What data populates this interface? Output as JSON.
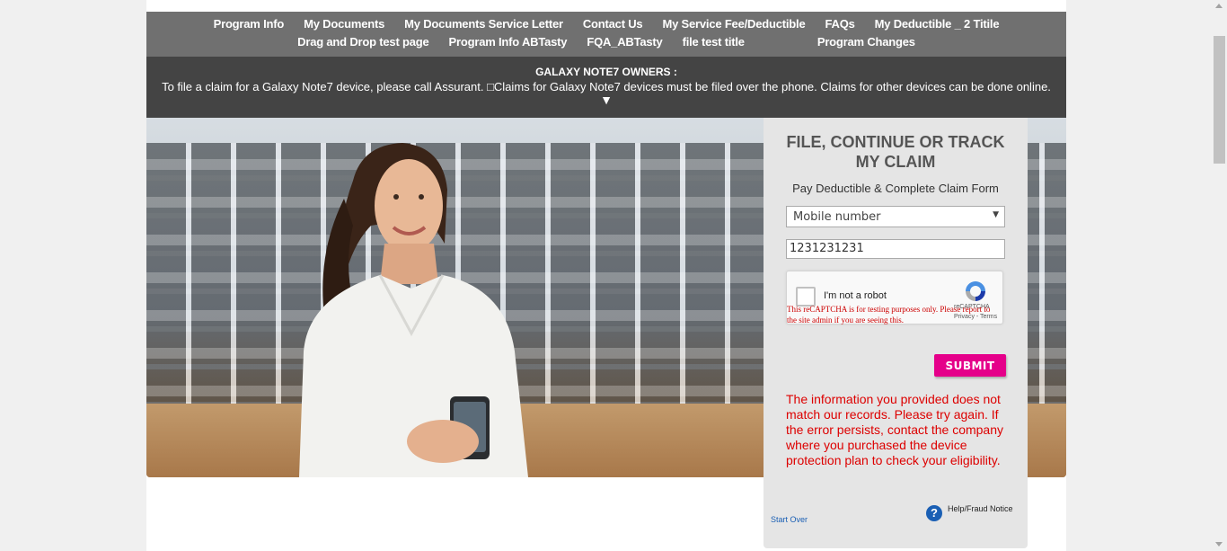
{
  "nav": {
    "row1": [
      "Program Info",
      "My Documents",
      "My Documents Service Letter",
      "Contact Us",
      "My Service Fee/Deductible",
      "FAQs",
      "My Deductible _ 2 Titile"
    ],
    "row2": [
      "Drag and Drop test page",
      "Program Info ABTasty",
      "FQA_ABTasty",
      "file test title",
      "Program Changes"
    ]
  },
  "banner": {
    "title": "GALAXY NOTE7 OWNERS :",
    "text": "To file a claim for a Galaxy Note7 device, please call Assurant. □Claims for Galaxy Note7 devices must be filed over the phone. Claims for other devices can be done online.",
    "toggle": "▼"
  },
  "claim": {
    "title_line1": "FILE, CONTINUE OR TRACK",
    "title_line2": "MY CLAIM",
    "subtitle": "Pay Deductible & Complete Claim Form",
    "select_value": "Mobile number",
    "select_arrow": "▼",
    "input_value": "1231231231",
    "captcha": {
      "label": "I'm not a robot",
      "brand": "reCAPTCHA",
      "terms": "Privacy - Terms",
      "warning": "This reCAPTCHA is for testing purposes only. Please report to the site admin if you are seeing this."
    },
    "submit_label": "SUBMIT",
    "error": "The information you provided does not match our records. Please try again. If the error persists, contact the company where you purchased the device protection plan to check your eligibility.",
    "start_over": "Start Over",
    "help_icon": "?",
    "help_text": "Help/Fraud Notice"
  },
  "colors": {
    "nav_bg": "#707070",
    "banner_bg": "#444444",
    "submit_bg": "#e5008a",
    "error": "#dd0000"
  },
  "icons": [
    "chevron-down-icon",
    "recaptcha-icon",
    "help-icon",
    "checkbox-icon"
  ]
}
